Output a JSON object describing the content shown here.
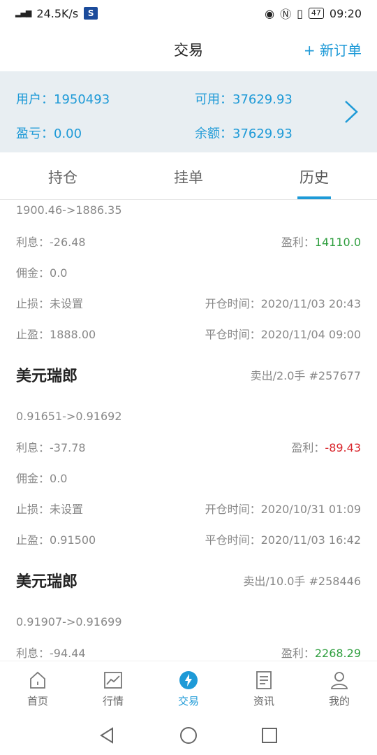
{
  "status_bar": {
    "signal": "4G",
    "speed": "24.5K/s",
    "battery": "47",
    "time": "09:20"
  },
  "header": {
    "title": "交易",
    "new_order": "+ 新订单"
  },
  "account": {
    "user": "用户：1950493",
    "available": "可用：37629.93",
    "pnl": "盈亏：0.00",
    "balance": "余额：37629.93"
  },
  "tabs": [
    {
      "label": "持仓"
    },
    {
      "label": "挂单"
    },
    {
      "label": "历史"
    }
  ],
  "orders": [
    {
      "price_range": "1900.46->1886.35",
      "interest_label": "利息：",
      "interest": "-26.48",
      "profit_label": "盈利：",
      "profit": "14110.0",
      "commission_label": "佣金：",
      "commission": "0.0",
      "stop_loss_label": "止损：",
      "stop_loss": "未设置",
      "open_time_label": "开仓时间：",
      "open_time": "2020/11/03 20:43",
      "take_profit_label": "止盈：",
      "take_profit": "1888.00",
      "close_time_label": "平仓时间：",
      "close_time": "2020/11/04 09:00"
    },
    {
      "symbol": "美元瑞郎",
      "meta": "卖出/2.0手 #257677",
      "price_range": "0.91651->0.91692",
      "interest_label": "利息：",
      "interest": "-37.78",
      "profit_label": "盈利：",
      "profit": "-89.43",
      "commission_label": "佣金：",
      "commission": "0.0",
      "stop_loss_label": "止损：",
      "stop_loss": "未设置",
      "open_time_label": "开仓时间：",
      "open_time": "2020/10/31 01:09",
      "take_profit_label": "止盈：",
      "take_profit": "0.91500",
      "close_time_label": "平仓时间：",
      "close_time": "2020/11/03 16:42"
    },
    {
      "symbol": "美元瑞郎",
      "meta": "卖出/10.0手 #258446",
      "price_range": "0.91907->0.91699",
      "interest_label": "利息：",
      "interest": "-94.44",
      "profit_label": "盈利：",
      "profit": "2268.29"
    }
  ],
  "bottom_nav": [
    {
      "label": "首页",
      "icon": "home-icon"
    },
    {
      "label": "行情",
      "icon": "chart-icon"
    },
    {
      "label": "交易",
      "icon": "trade-icon"
    },
    {
      "label": "资讯",
      "icon": "news-icon"
    },
    {
      "label": "我的",
      "icon": "profile-icon"
    }
  ],
  "colors": {
    "accent": "#1e9ad7",
    "profit_positive": "#2e9e3e",
    "profit_negative": "#d9262c",
    "panel_bg": "#e8eef2"
  }
}
